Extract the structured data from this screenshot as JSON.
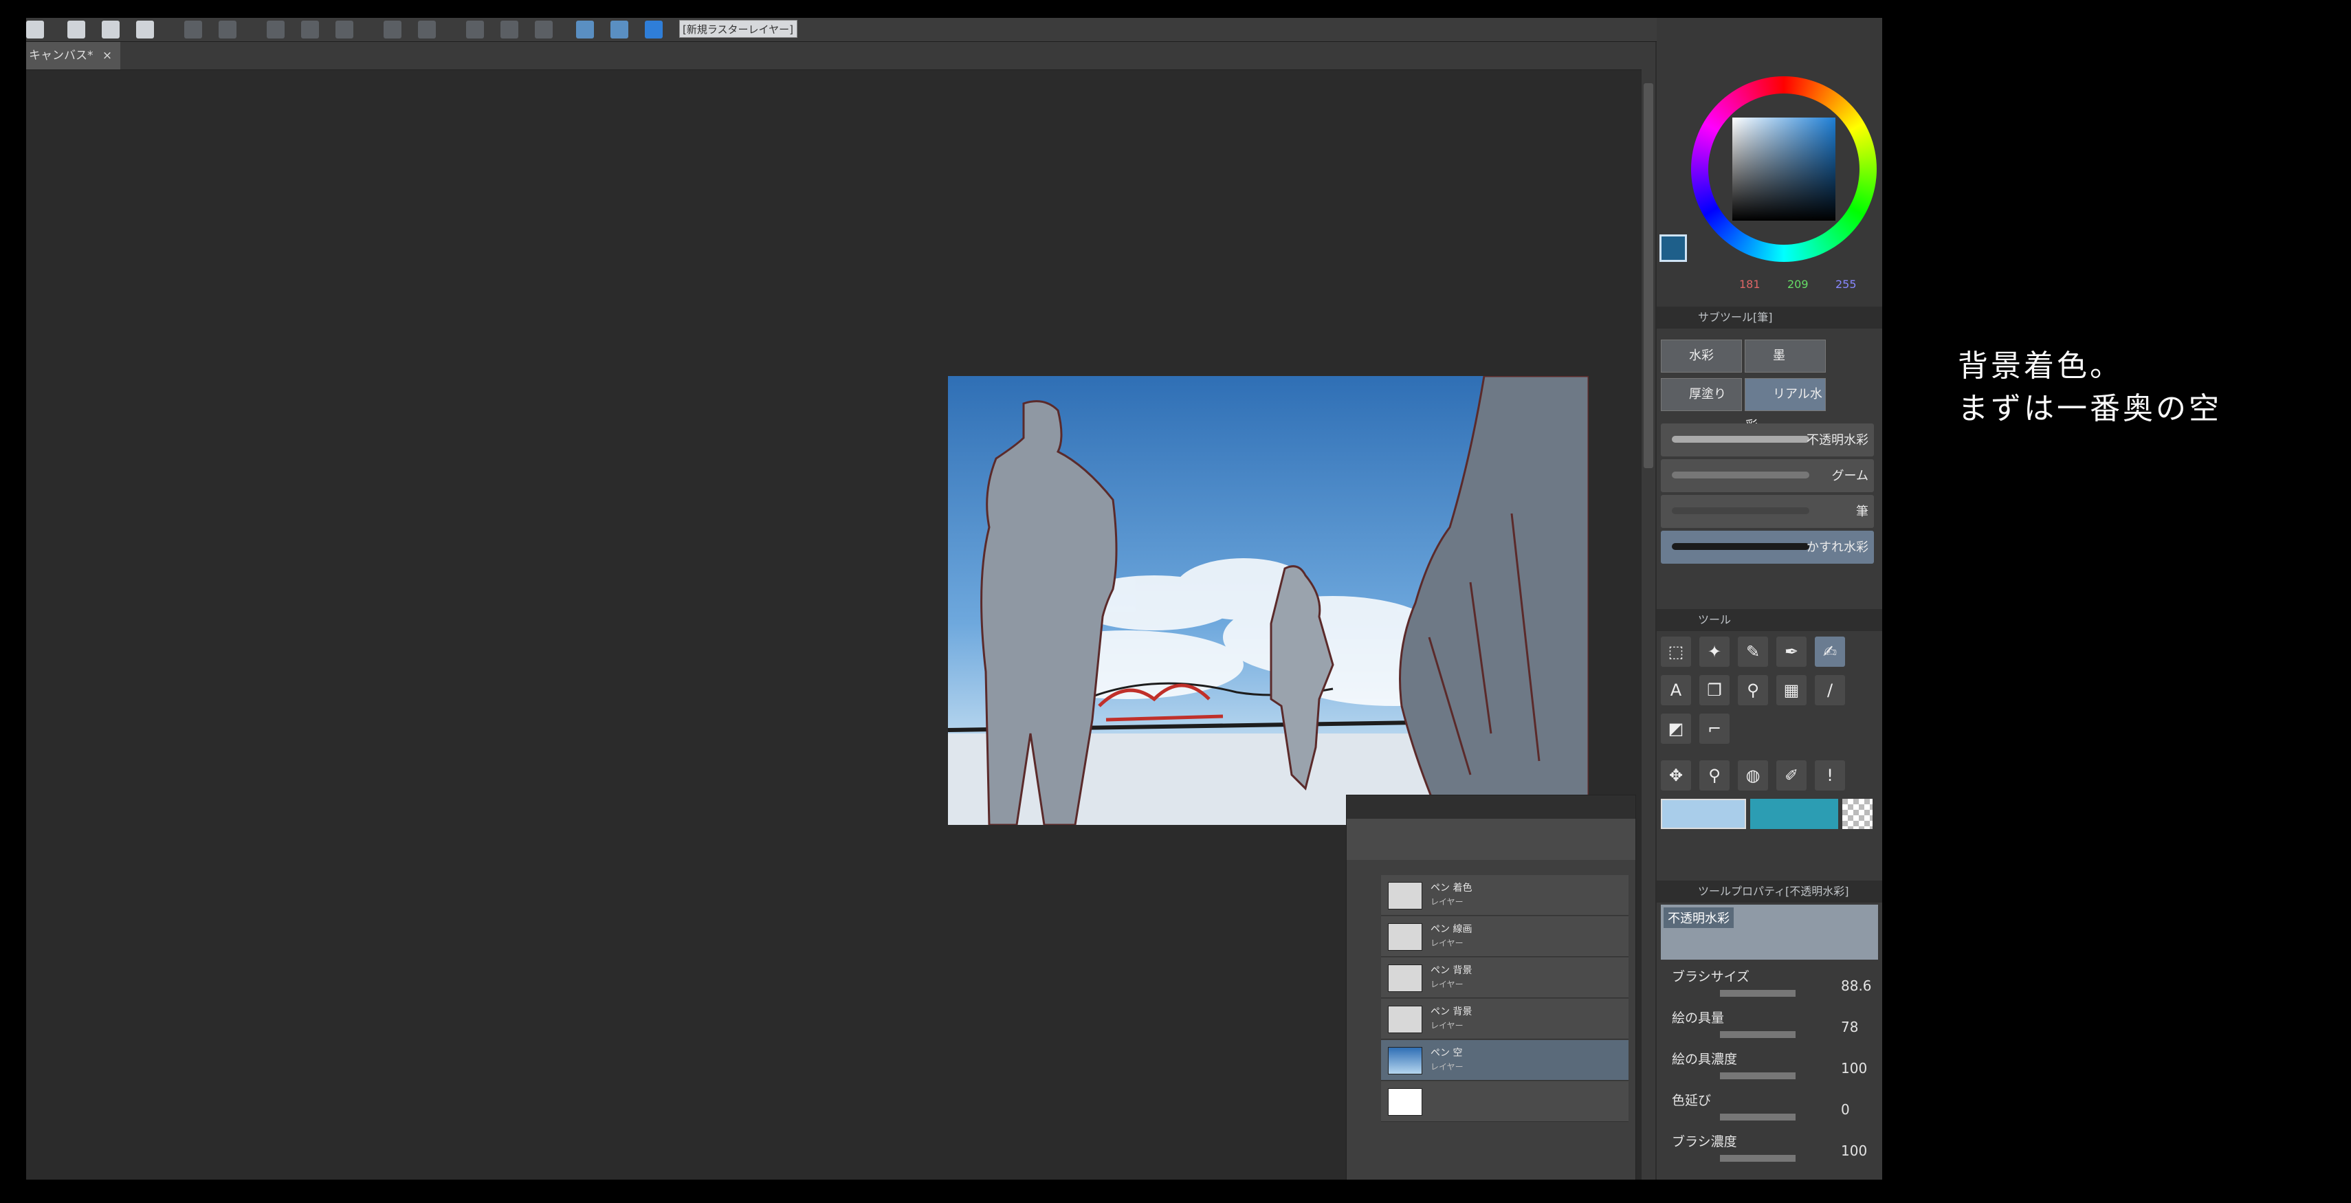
{
  "toolbar": {
    "layer_field": "[新規ラスターレイヤー]"
  },
  "canvas_tab": {
    "label": "キャンバス*"
  },
  "color_panel": {
    "main_color": "#1e5f8a",
    "r": "181",
    "g": "209",
    "b": "255"
  },
  "subtool_panel": {
    "title": "サブツール[筆]",
    "tabs": [
      "水彩",
      "墨",
      "厚塗り",
      "リアル水彩"
    ],
    "brushes": [
      "不透明水彩",
      "グーム",
      "筆",
      "かすれ水彩"
    ]
  },
  "tool_panel": {
    "title": "ツール"
  },
  "colors": {
    "light_blue": "#a9cdea",
    "teal": "#2c9db3"
  },
  "tool_property": {
    "title": "ツールプロパティ[不透明水彩]",
    "brush_name": "不透明水彩",
    "props": [
      {
        "label": "ブラシサイズ",
        "value": "88.6"
      },
      {
        "label": "絵の具量",
        "value": "78"
      },
      {
        "label": "絵の具濃度",
        "value": "100"
      },
      {
        "label": "色延び",
        "value": "0"
      },
      {
        "label": "ブラシ濃度",
        "value": "100"
      }
    ]
  },
  "layer_panel": {
    "layers": [
      {
        "name": "ペン 着色",
        "mode": "レイヤー"
      },
      {
        "name": "ペン 線画",
        "mode": "レイヤー"
      },
      {
        "name": "ペン 背景",
        "mode": "レイヤー"
      },
      {
        "name": "ペン 背景",
        "mode": "レイヤー"
      },
      {
        "name": "ペン 空",
        "mode": "レイヤー"
      },
      {
        "name": "",
        "mode": ""
      }
    ]
  },
  "caption": {
    "line1": "背景着色。",
    "line2": "まずは一番奥の空"
  }
}
